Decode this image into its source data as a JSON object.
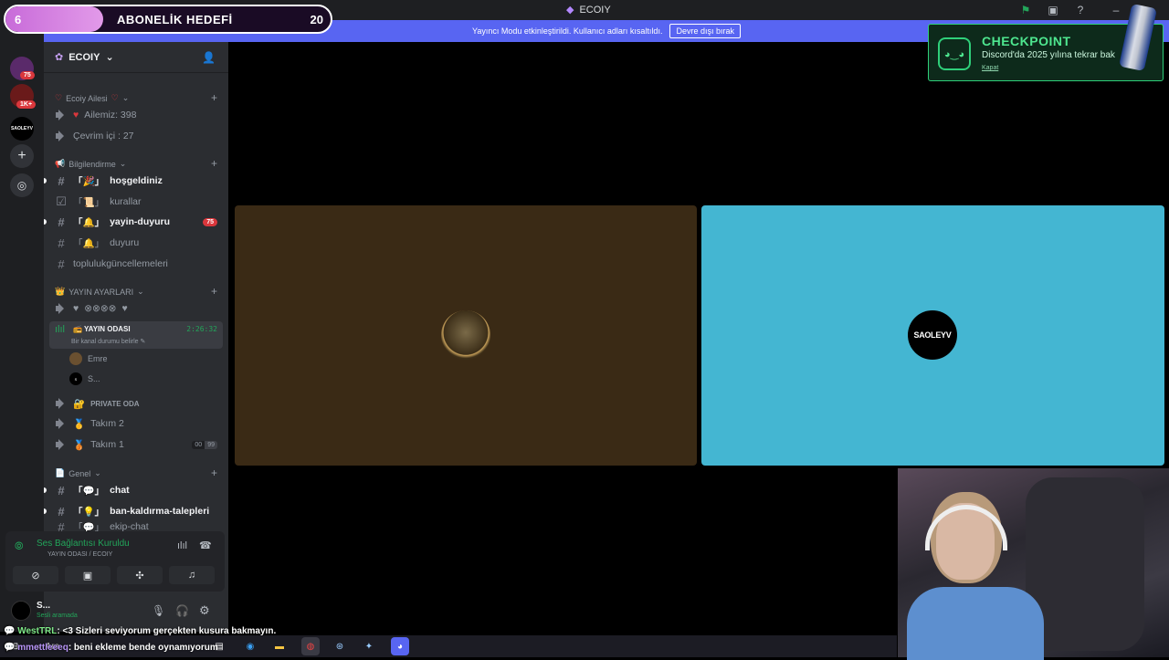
{
  "window": {
    "title": "ECOIY"
  },
  "goal": {
    "current": "6",
    "label": "ABONELİK HEDEFİ",
    "target": "20",
    "progress": 0.3
  },
  "streamer_banner": {
    "text": "Yayıncı Modu etkinleştirildi. Kullanıcı adları kısaltıldı.",
    "button": "Devre dışı bırak"
  },
  "rail": {
    "badges": [
      "75",
      "1K+"
    ],
    "server_label": "SAOLEYV"
  },
  "server": {
    "name": "ECOIY"
  },
  "categories": [
    {
      "name": "Ecoiy Ailesi"
    },
    {
      "name": "Bilgilendirme"
    },
    {
      "name": "YAYIN AYARLARI"
    },
    {
      "name": "Genel"
    }
  ],
  "channels": {
    "ailemiz": "Ailemiz: 398",
    "cevrimici": "Çevrim içi : 27",
    "hosgeldiniz": "hoşgeldiniz",
    "kurallar": "kurallar",
    "yayin_duyuru": "yayin-duyuru",
    "yayin_duyuru_badge": "75",
    "duyuru": "duyuru",
    "topluluk": "toplulukgüncellemeleri",
    "hearts": "♥",
    "yayin_odasi": "YAYIN ODASI",
    "yayin_odasi_status": "Bir kanal durumu belirle",
    "yayin_odasi_timer": "2:26:32",
    "private_oda": "PRIVATE ODA",
    "takim2": "Takım 2",
    "takim1": "Takım 1",
    "takim1_counts": [
      "00",
      "99"
    ],
    "chat": "chat",
    "ban": "ban-kaldırma-talepleri",
    "ekip": "ekip-chat"
  },
  "voice_users": [
    "Emre",
    "S..."
  ],
  "voice_panel": {
    "title": "Ses Bağlantısı Kuruldu",
    "subtitle": "YAYIN ODASI / ECOIY"
  },
  "user": {
    "name": "S...",
    "status": "Sesli aramada"
  },
  "tiles": {
    "tile2_label": "SAOLEYV"
  },
  "checkpoint": {
    "title": "CHECKPOINT",
    "desc": "Discord'da 2025 yılına tekrar bak",
    "link": "Kapat"
  },
  "chat_overlay": [
    {
      "user": "WestTRL",
      "msg": ": <3 Sizleri seviyorum gerçekten kusura bakmayın."
    },
    {
      "user": "mmettleeeq",
      "msg": ": beni ekleme bende oynamıyorum"
    }
  ],
  "taskbar": {
    "search": "Ara"
  },
  "colors": {
    "accent": "#5865f2",
    "online": "#23a55a",
    "tile2": "#44b6d2",
    "tile1": "#3a2a15",
    "checkpoint": "#4ee68f"
  }
}
